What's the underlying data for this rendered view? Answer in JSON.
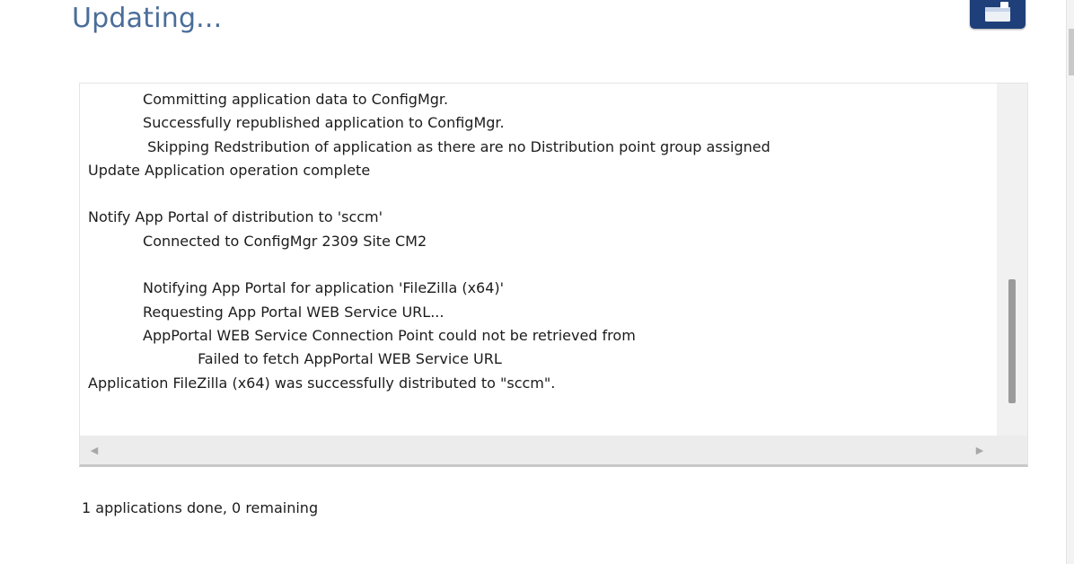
{
  "window": {
    "title": "Updating..."
  },
  "toolbar": {
    "corner_icon": "window-icon"
  },
  "log": {
    "lines": [
      "            Committing application data to ConfigMgr.",
      "            Successfully republished application to ConfigMgr.",
      "             Skipping Redstribution of application as there are no Distribution point group assigned",
      "Update Application operation complete",
      "",
      "Notify App Portal of distribution to 'sccm'",
      "            Connected to ConfigMgr 2309 Site CM2",
      "",
      "            Notifying App Portal for application 'FileZilla (x64)'",
      "            Requesting App Portal WEB Service URL...",
      "            AppPortal WEB Service Connection Point could not be retrieved from",
      "                        Failed to fetch AppPortal WEB Service URL",
      "Application FileZilla (x64) was successfully distributed to \"sccm\"."
    ]
  },
  "scrollbars": {
    "left_arrow": "◀",
    "right_arrow": "▶"
  },
  "status": {
    "text": "1 applications done, 0 remaining"
  },
  "colors": {
    "title": "#4a6d99",
    "corner_button": "#1f3f7a"
  }
}
